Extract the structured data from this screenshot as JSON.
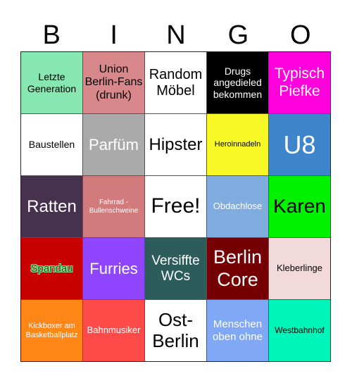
{
  "title_letters": [
    "B",
    "I",
    "N",
    "G",
    "O"
  ],
  "cells": [
    {
      "text": "Letzte Generation",
      "bg": "#86e8b0",
      "color": "#000000",
      "size": 14
    },
    {
      "text": "Union Berlin-Fans (drunk)",
      "bg": "#d8888a",
      "color": "#000000",
      "size": 16
    },
    {
      "text": "Random Möbel",
      "bg": "#ffffff",
      "color": "#000000",
      "size": 20
    },
    {
      "text": "Drugs angedieled bekommen",
      "bg": "#000000",
      "color": "#ffffff",
      "size": 14
    },
    {
      "text": "Typisch Piefke",
      "bg": "#ff00dd",
      "color": "#ffffff",
      "size": 21
    },
    {
      "text": "Baustellen",
      "bg": "#ffffff",
      "color": "#000000",
      "size": 14
    },
    {
      "text": "Parfüm",
      "bg": "#aaaaaa",
      "color": "#ffffff",
      "size": 22
    },
    {
      "text": "Hipster",
      "bg": "#ffffff",
      "color": "#000000",
      "size": 24
    },
    {
      "text": "Heroinnadeln",
      "bg": "#f8f826",
      "color": "#000000",
      "size": 11
    },
    {
      "text": "U8",
      "bg": "#3e85cc",
      "color": "#ffffff",
      "size": 36
    },
    {
      "text": "Ratten",
      "bg": "#46314f",
      "color": "#ffffff",
      "size": 24
    },
    {
      "text": "Fahrrad - Bullenschweine",
      "bg": "#d17b7d",
      "color": "#ffffff",
      "size": 10
    },
    {
      "text": "Free!",
      "bg": "#ffffff",
      "color": "#000000",
      "size": 30
    },
    {
      "text": "Obdachlose",
      "bg": "#80ace0",
      "color": "#ffffff",
      "size": 13
    },
    {
      "text": "Karen",
      "bg": "#00f200",
      "color": "#000000",
      "size": 28
    },
    {
      "text": "Spandau",
      "bg": "#c80000",
      "color": "#2a4a2a",
      "size": 15,
      "outlined": true
    },
    {
      "text": "Furries",
      "bg": "#9045ff",
      "color": "#ffffff",
      "size": 22
    },
    {
      "text": "Versiffte WCs",
      "bg": "#2c5d5a",
      "color": "#ffffff",
      "size": 19
    },
    {
      "text": "Berlin Core",
      "bg": "#740003",
      "color": "#ffffff",
      "size": 27
    },
    {
      "text": "Kleberlinge",
      "bg": "#f2dadb",
      "color": "#000000",
      "size": 13
    },
    {
      "text": "Kickboxer am Basketballplatz",
      "bg": "#ff8617",
      "color": "#ffffff",
      "size": 11
    },
    {
      "text": "Bahnmusiker",
      "bg": "#ff4a4a",
      "color": "#ffffff",
      "size": 13
    },
    {
      "text": "Ost-Berlin",
      "bg": "#ffffff",
      "color": "#000000",
      "size": 26
    },
    {
      "text": "Menschen oben ohne",
      "bg": "#80a8f5",
      "color": "#ffffff",
      "size": 15
    },
    {
      "text": "Westbahnhof",
      "bg": "#00f5bb",
      "color": "#000000",
      "size": 12
    }
  ]
}
